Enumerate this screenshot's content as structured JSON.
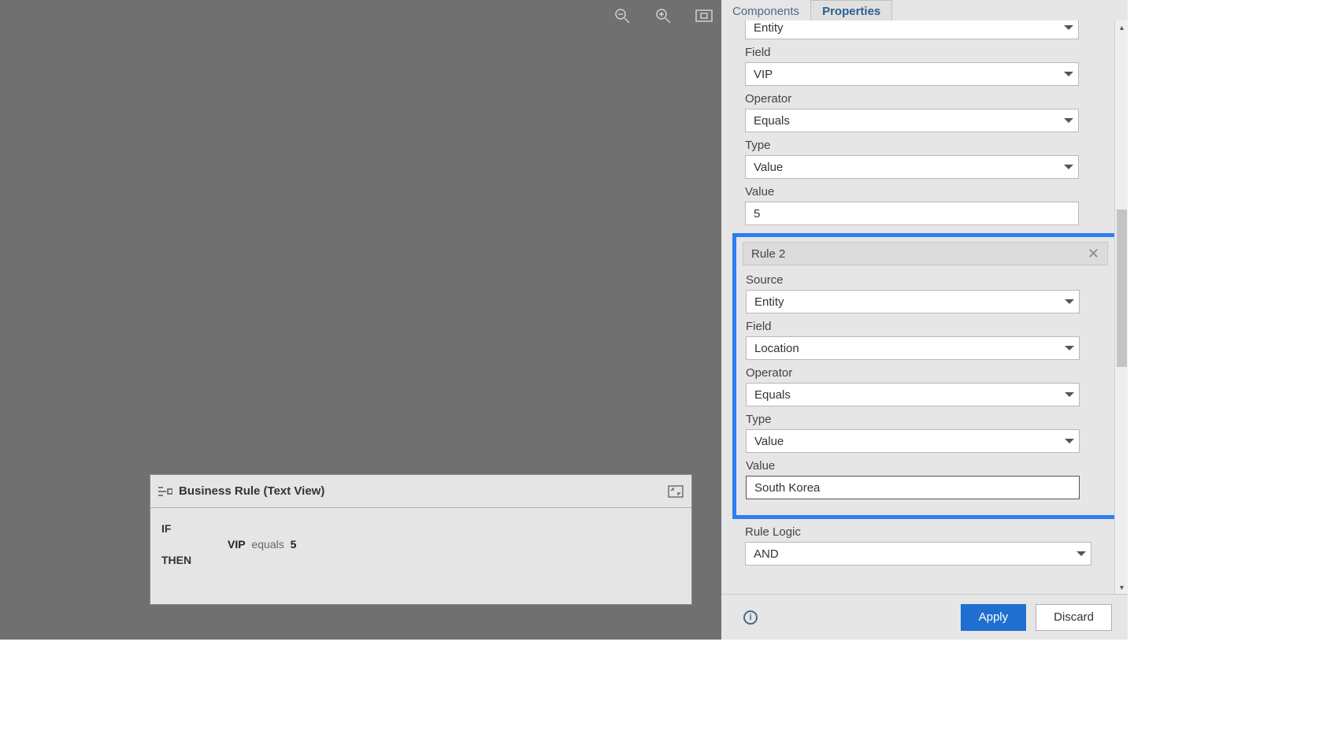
{
  "canvas": {
    "toolbar": {
      "zoom_out": "zoom-out",
      "zoom_in": "zoom-in",
      "fit": "fit-to-screen"
    }
  },
  "text_view": {
    "title": "Business Rule (Text View)",
    "if_label": "IF",
    "then_label": "THEN",
    "expr_field": "VIP",
    "expr_op": "equals",
    "expr_val": "5"
  },
  "tabs": {
    "components": "Components",
    "properties": "Properties"
  },
  "rule1": {
    "source_label": "",
    "source_value": "Entity",
    "field_label": "Field",
    "field_value": "VIP",
    "operator_label": "Operator",
    "operator_value": "Equals",
    "type_label": "Type",
    "type_value": "Value",
    "value_label": "Value",
    "value_value": "5"
  },
  "rule2": {
    "header": "Rule 2",
    "source_label": "Source",
    "source_value": "Entity",
    "field_label": "Field",
    "field_value": "Location",
    "operator_label": "Operator",
    "operator_value": "Equals",
    "type_label": "Type",
    "type_value": "Value",
    "value_label": "Value",
    "value_value": "South Korea"
  },
  "rule_logic": {
    "label": "Rule Logic",
    "value": "AND"
  },
  "footer": {
    "apply": "Apply",
    "discard": "Discard"
  }
}
